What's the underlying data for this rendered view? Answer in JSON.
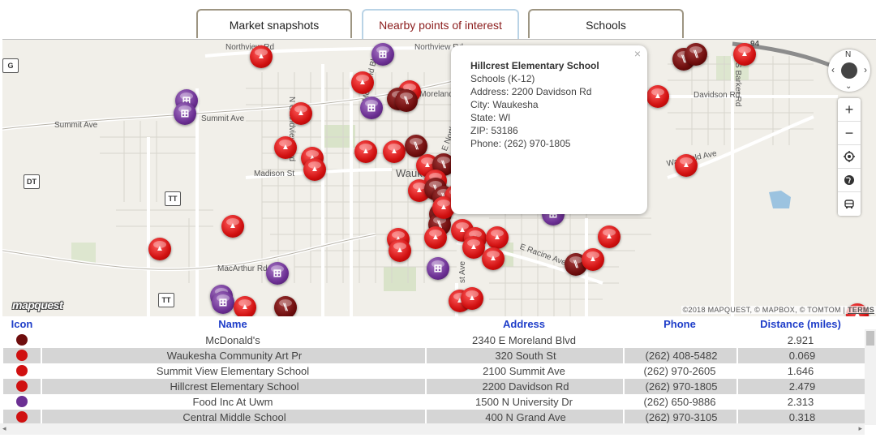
{
  "tabs": [
    {
      "label": "Market snapshots"
    },
    {
      "label": "Nearby points of interest"
    },
    {
      "label": "Schools"
    }
  ],
  "map": {
    "road_labels": [
      "Northview Rd",
      "Northview Rd",
      "N Grandview Blvd",
      "N Moreland Blvd",
      "W Moreland",
      "E North",
      "Summit Ave",
      "Summit Ave",
      "Madison St",
      "Waukesha",
      "MacArthur Rd",
      "E Racine Ave",
      "st Ave",
      "Davidson Rd",
      "S Barker Rd",
      "Wakefield Ave",
      "94"
    ],
    "shields": [
      "G",
      "DT",
      "TT",
      "TT"
    ],
    "popup": {
      "close": "×",
      "title": "Hillcrest Elementary School",
      "category": "Schools (K-12)",
      "address": "Address: 2200 Davidson Rd",
      "city": "City: Waukesha",
      "state": "State: WI",
      "zip": "ZIP: 53186",
      "phone": "Phone: (262) 970-1805"
    },
    "controls": {
      "compass_n": "N",
      "compass_left": "‹",
      "compass_right": "›",
      "compass_down": "⌄",
      "zoom_in": "+",
      "zoom_out": "−"
    },
    "logo": "mapquest",
    "attribution": {
      "text": "©2018 MAPQUEST, © MAPBOX, © TOMTOM |",
      "terms": "TERMS"
    },
    "colors": {
      "school": "#d01010",
      "food": "#6e0d0d",
      "shop": "#6b2f93"
    }
  },
  "table": {
    "headers": {
      "icon": "Icon",
      "name": "Name",
      "address": "Address",
      "phone": "Phone",
      "distance": "Distance (miles)"
    },
    "rows": [
      {
        "icon": "food-icon",
        "name": "McDonald's",
        "address": "2340 E Moreland Blvd",
        "phone": "",
        "distance": "2.921"
      },
      {
        "icon": "school-icon",
        "name": "Waukesha Community Art Pr",
        "address": "320 South St",
        "phone": "(262) 408-5482",
        "distance": "0.069"
      },
      {
        "icon": "school-icon",
        "name": "Summit View Elementary School",
        "address": "2100 Summit Ave",
        "phone": "(262) 970-2605",
        "distance": "1.646"
      },
      {
        "icon": "school-icon",
        "name": "Hillcrest Elementary School",
        "address": "2200 Davidson Rd",
        "phone": "(262) 970-1805",
        "distance": "2.479"
      },
      {
        "icon": "shopping-icon",
        "name": "Food Inc At Uwm",
        "address": "1500 N University Dr",
        "phone": "(262) 650-9886",
        "distance": "2.313"
      },
      {
        "icon": "school-icon",
        "name": "Central Middle School",
        "address": "400 N Grand Ave",
        "phone": "(262) 970-3105",
        "distance": "0.318"
      }
    ]
  }
}
